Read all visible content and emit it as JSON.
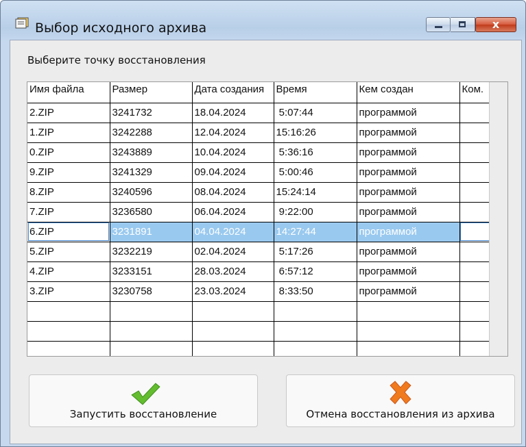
{
  "window": {
    "title": "Выбор исходного архива",
    "close_glyph": "x"
  },
  "prompt": "Выберите точку восстановления",
  "table": {
    "columns": [
      "Имя файла",
      "Размер",
      "Дата создания",
      "Время",
      "Кем создан",
      "Ком."
    ],
    "rows": [
      [
        "2.ZIP",
        "3241732",
        "18.04.2024",
        " 5:07:44",
        "программой",
        ""
      ],
      [
        "1.ZIP",
        "3242288",
        "12.04.2024",
        "15:16:26",
        "программой",
        ""
      ],
      [
        "0.ZIP",
        "3243889",
        "10.04.2024",
        " 5:36:16",
        "программой",
        ""
      ],
      [
        "9.ZIP",
        "3241329",
        "09.04.2024",
        " 5:00:46",
        "программой",
        ""
      ],
      [
        "8.ZIP",
        "3240596",
        "08.04.2024",
        "15:24:14",
        "программой",
        ""
      ],
      [
        "7.ZIP",
        "3236580",
        "06.04.2024",
        " 9:22:00",
        "программой",
        ""
      ],
      [
        "6.ZIP",
        "3231891",
        "04.04.2024",
        "14:27:44",
        "программой",
        ""
      ],
      [
        "5.ZIP",
        "3232219",
        "02.04.2024",
        " 5:17:26",
        "программой",
        ""
      ],
      [
        "4.ZIP",
        "3233151",
        "28.03.2024",
        " 6:57:12",
        "программой",
        ""
      ],
      [
        "3.ZIP",
        "3230758",
        "23.03.2024",
        " 8:33:50",
        "программой",
        ""
      ],
      [
        "",
        "",
        "",
        "",
        "",
        ""
      ],
      [
        "",
        "",
        "",
        "",
        "",
        ""
      ],
      [
        "",
        "",
        "",
        "",
        "",
        ""
      ]
    ],
    "selected_row": 6
  },
  "buttons": {
    "restore": {
      "label": "Запустить восстановление",
      "icon": "checkmark-icon",
      "color": "#5cb82e"
    },
    "cancel": {
      "label": "Отмена восстановления из архива",
      "icon": "cross-icon",
      "color": "#f07a1e"
    }
  }
}
